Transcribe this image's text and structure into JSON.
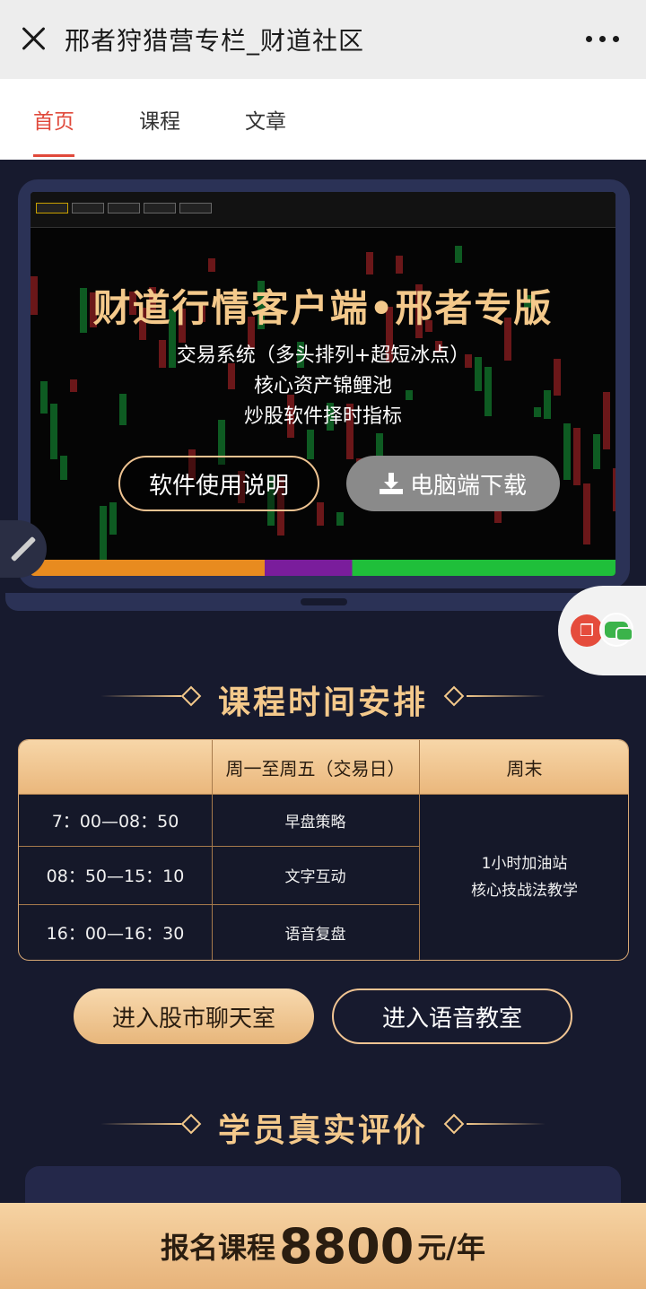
{
  "window": {
    "title": "邢者狩猎营专栏_财道社区"
  },
  "icons": {
    "close": "close-icon",
    "more": "more-icon",
    "edit": "pencil-icon",
    "gift": "gift-icon",
    "chat": "wechat-icon",
    "download": "download-icon"
  },
  "tabs": [
    {
      "label": "首页",
      "active": true
    },
    {
      "label": "课程",
      "active": false
    },
    {
      "label": "文章",
      "active": false
    }
  ],
  "banner": {
    "title": "财道行情客户端•邢者专版",
    "lines": [
      "交易系统（多头排列+超短冰点）",
      "核心资产锦鲤池",
      "炒股软件择时指标"
    ],
    "manual_button": "软件使用说明",
    "download_button": "电脑端下载"
  },
  "schedule": {
    "heading": "课程时间安排",
    "columns": [
      "",
      "周一至周五（交易日）",
      "周末"
    ],
    "rows": [
      {
        "time": "7：00—08：50",
        "weekday": "早盘策略"
      },
      {
        "time": "08：50—15：10",
        "weekday": "文字互动"
      },
      {
        "time": "16：00—16：30",
        "weekday": "语音复盘"
      }
    ],
    "weekend": [
      "1小时加油站",
      "核心技战法教学"
    ]
  },
  "actions": {
    "chat_room": "进入股市聊天室",
    "voice_room": "进入语音教室"
  },
  "reviews": {
    "heading": "学员真实评价"
  },
  "signup": {
    "prefix": "报名课程",
    "price": "8800",
    "suffix": "元/年"
  },
  "colors": {
    "accent": "#e0493b",
    "gold": "#f4c98b",
    "background": "#171a2e"
  }
}
